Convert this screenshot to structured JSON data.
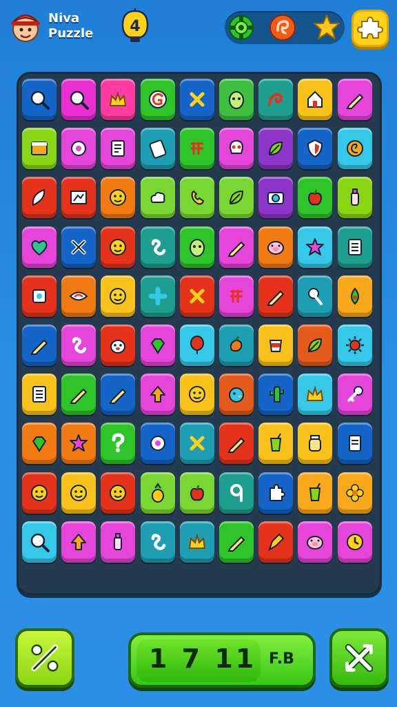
{
  "app": {
    "name_line1": "Niva",
    "name_line2": "Puzzle",
    "level": "4"
  },
  "header_icons": [
    "gear-icon",
    "orange-swirl-icon",
    "star-icon",
    "puzzle-piece-icon"
  ],
  "board": {
    "rows": 10,
    "cols": 9,
    "tiles": [
      [
        "#1565c8",
        "#ea2fd2",
        "#ff3aa0",
        "#2fc42a",
        "#1565c8",
        "#3fbf3f",
        "#1e9e8e",
        "#f8c21a",
        "#e545d8"
      ],
      [
        "#8bd614",
        "#e545d8",
        "#e545d8",
        "#1e9eb3",
        "#2fc42a",
        "#e545d8",
        "#8d35c9",
        "#1565c8",
        "#36c8e8"
      ],
      [
        "#e5331b",
        "#e5331b",
        "#f27a12",
        "#7ad632",
        "#7ad632",
        "#7ad632",
        "#8d35c9",
        "#2fc42a",
        "#8bd614"
      ],
      [
        "#e545d8",
        "#1565c8",
        "#e5331b",
        "#1e9e8e",
        "#2fc42a",
        "#e545d8",
        "#f27a12",
        "#36c8e8",
        "#1e9e8e"
      ],
      [
        "#e5331b",
        "#f27a12",
        "#f8c21a",
        "#1e9e8e",
        "#e5331b",
        "#e545d8",
        "#e5331b",
        "#1e9eb3",
        "#f8a81a"
      ],
      [
        "#1565c8",
        "#e545d8",
        "#e5331b",
        "#e545d8",
        "#36c8e8",
        "#1e9eb3",
        "#f8c21a",
        "#e55b1b",
        "#36c8e8"
      ],
      [
        "#f8c21a",
        "#2fc42a",
        "#1565c8",
        "#e545d8",
        "#f8c21a",
        "#e55b1b",
        "#1565c8",
        "#36c8e8",
        "#e545d8"
      ],
      [
        "#f27a12",
        "#f27a12",
        "#2fc42a",
        "#1565c8",
        "#1e9eb3",
        "#e5331b",
        "#f8c21a",
        "#f8c21a",
        "#1565c8"
      ],
      [
        "#e5331b",
        "#f8c21a",
        "#e5331b",
        "#7ad632",
        "#7ad632",
        "#1e9e8e",
        "#1565c8",
        "#f8a81a",
        "#f8a81a"
      ],
      [
        "#36c8e8",
        "#e545d8",
        "#e545d8",
        "#1e9eb3",
        "#1e9eb3",
        "#2fc42a",
        "#e5331b",
        "#e545d8",
        "#e545d8"
      ]
    ],
    "glyphs": [
      [
        "search",
        "search",
        "crown",
        "letter-g",
        "cross",
        "face",
        "swirl",
        "house",
        "pencil"
      ],
      [
        "window",
        "gear",
        "book",
        "phone",
        "grid",
        "skull",
        "leaf",
        "shield",
        "spiral"
      ],
      [
        "feather",
        "board",
        "smile",
        "cloud",
        "phone-curl",
        "leaf",
        "camera",
        "apple",
        "bottle"
      ],
      [
        "heart",
        "tools",
        "smile",
        "curl",
        "face",
        "pencil",
        "pig",
        "star",
        "list"
      ],
      [
        "square",
        "eye",
        "smile",
        "plus",
        "cross",
        "grid",
        "pencil",
        "pin",
        "drop"
      ],
      [
        "pencil",
        "curl",
        "dog",
        "gem",
        "balloon",
        "fruit",
        "cup",
        "leaf",
        "sun"
      ],
      [
        "list",
        "pencil",
        "pencil",
        "arrow-up",
        "smile",
        "bird",
        "cactus",
        "crown",
        "key"
      ],
      [
        "gem",
        "star",
        "question",
        "gear",
        "cross",
        "pencil",
        "drink",
        "jar",
        "doc"
      ],
      [
        "smile",
        "smile",
        "smile",
        "pineapple",
        "apple",
        "nine",
        "puzzle",
        "drink",
        "flower"
      ],
      [
        "search",
        "arrow-up",
        "bottle",
        "curl",
        "crown",
        "pencil",
        "pen",
        "pig",
        "clock"
      ]
    ]
  },
  "score": {
    "value": "1 7 11",
    "sub": "F.B"
  },
  "colors": {
    "background": "#2a8fe3",
    "board": "#233a4f",
    "accent_green": "#38c617",
    "accent_yellow": "#ffd21a"
  }
}
